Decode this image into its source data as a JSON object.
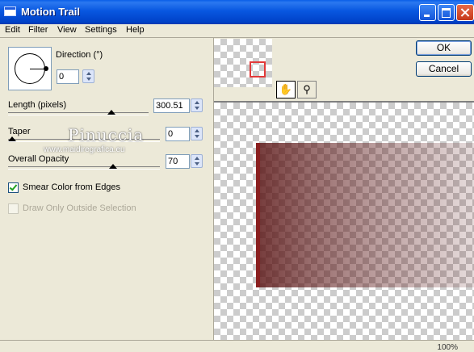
{
  "window": {
    "title": "Motion Trail"
  },
  "menu": [
    "Edit",
    "Filter",
    "View",
    "Settings",
    "Help"
  ],
  "direction": {
    "label": "Direction (°)",
    "value": "0"
  },
  "length": {
    "label": "Length (pixels)",
    "value": "300.51",
    "slider_fraction": 0.75
  },
  "taper": {
    "label": "Taper",
    "value": "0",
    "slider_fraction": 0.0
  },
  "opacity": {
    "label": "Overall Opacity",
    "value": "70",
    "slider_fraction": 0.7
  },
  "smear": {
    "label": "Smear Color from Edges",
    "checked": true
  },
  "draw_only": {
    "label": "Draw Only Outside Selection",
    "checked": false,
    "disabled": true
  },
  "watermark": {
    "name": "Pinuccia",
    "url": "www.maidiregrafica.eu"
  },
  "buttons": {
    "ok": "OK",
    "cancel": "Cancel"
  },
  "tools": {
    "pan": "pan-hand",
    "zoom": "zoom-magnifier"
  },
  "status": {
    "zoom": "100%"
  },
  "colors": {
    "trail": "#6E1414",
    "titlebar": "#0A5DE8",
    "view_rect": "#E23A3A"
  }
}
